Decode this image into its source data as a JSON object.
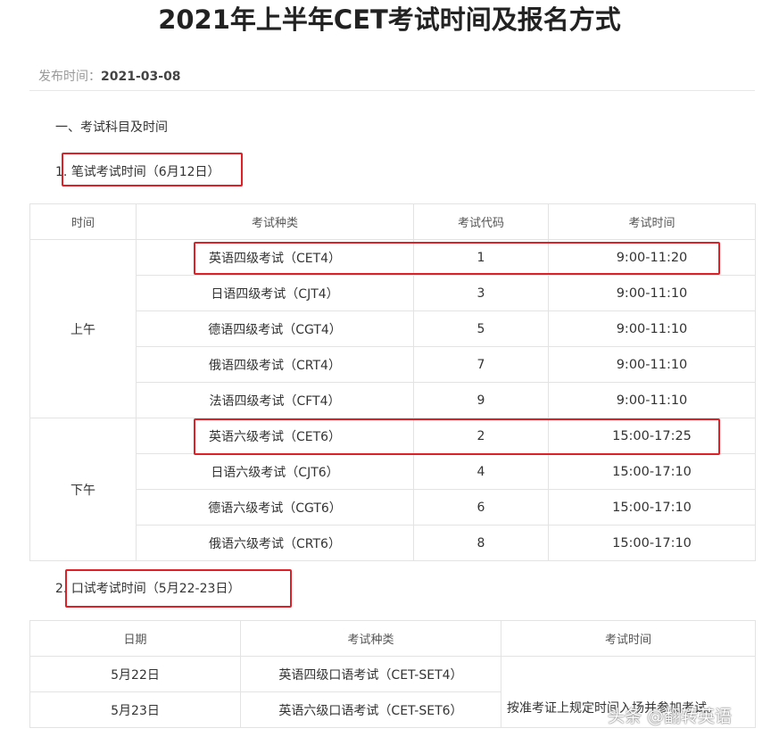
{
  "article": {
    "title": "2021年上半年CET考试时间及报名方式",
    "publish_label": "发布时间：",
    "publish_date": "2021-03-08"
  },
  "section1": {
    "heading": "一、考试科目及时间"
  },
  "written": {
    "heading_num": "1.",
    "heading_text": "笔试考试时间（6月12日）",
    "headers": [
      "时间",
      "考试种类",
      "考试代码",
      "考试时间"
    ],
    "morning_label": "上午",
    "afternoon_label": "下午",
    "morning_rows": [
      {
        "type": "英语四级考试（CET4）",
        "code": "1",
        "time": "9:00-11:20"
      },
      {
        "type": "日语四级考试（CJT4）",
        "code": "3",
        "time": "9:00-11:10"
      },
      {
        "type": "德语四级考试（CGT4）",
        "code": "5",
        "time": "9:00-11:10"
      },
      {
        "type": "俄语四级考试（CRT4）",
        "code": "7",
        "time": "9:00-11:10"
      },
      {
        "type": "法语四级考试（CFT4）",
        "code": "9",
        "time": "9:00-11:10"
      }
    ],
    "afternoon_rows": [
      {
        "type": "英语六级考试（CET6）",
        "code": "2",
        "time": "15:00-17:25"
      },
      {
        "type": "日语六级考试（CJT6）",
        "code": "4",
        "time": "15:00-17:10"
      },
      {
        "type": "德语六级考试（CGT6）",
        "code": "6",
        "time": "15:00-17:10"
      },
      {
        "type": "俄语六级考试（CRT6）",
        "code": "8",
        "time": "15:00-17:10"
      }
    ]
  },
  "oral": {
    "heading_num": "2.",
    "heading_text": "口试考试时间（5月22-23日）",
    "headers": [
      "日期",
      "考试种类",
      "考试时间"
    ],
    "rows": [
      {
        "date": "5月22日",
        "type": "英语四级口语考试（CET-SET4）"
      },
      {
        "date": "5月23日",
        "type": "英语六级口语考试（CET-SET6）"
      }
    ],
    "note": "按准考证上规定时间入场并参加考试。"
  },
  "watermark": "头条 @翻转英语",
  "colors": {
    "highlight": "#e11f27",
    "border": "#e3e3e3",
    "muted": "#999999"
  }
}
